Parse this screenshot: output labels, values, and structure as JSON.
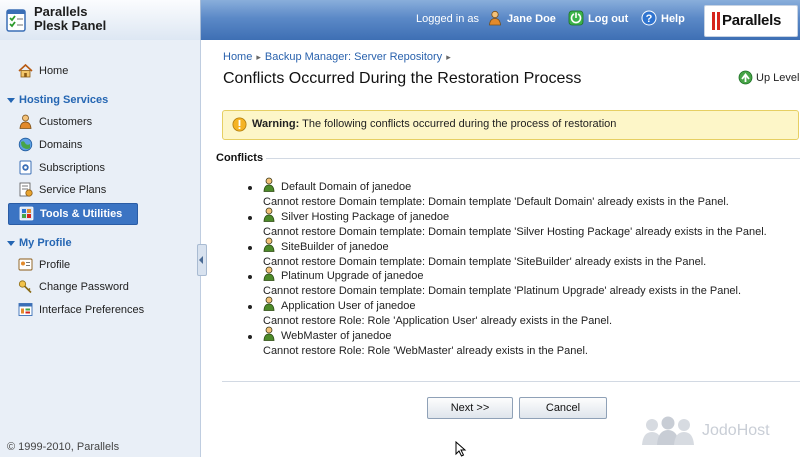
{
  "header": {
    "brand_line1": "Parallels",
    "brand_line2": "Plesk Panel",
    "logged_in_as": "Logged in as",
    "user_name": "Jane Doe",
    "logout_label": "Log out",
    "help_label": "Help",
    "logo_text": "Parallels"
  },
  "sidebar": {
    "home": "Home",
    "hosting_services_title": "Hosting Services",
    "hosting_items": [
      "Customers",
      "Domains",
      "Subscriptions",
      "Service Plans",
      "Tools & Utilities"
    ],
    "my_profile_title": "My Profile",
    "profile_items": [
      "Profile",
      "Change Password",
      "Interface Preferences"
    ],
    "copyright": "© 1999-2010, Parallels"
  },
  "main": {
    "breadcrumb": [
      "Home",
      "Backup Manager: Server Repository"
    ],
    "title": "Conflicts Occurred During the Restoration Process",
    "up_level": "Up Level",
    "warning_label": "Warning:",
    "warning_text": "The following conflicts occurred during the process of restoration",
    "conflicts_title": "Conflicts",
    "conflicts": [
      {
        "name": "Default Domain of janedoe",
        "message": "Cannot restore Domain template: Domain template 'Default Domain' already exists in the Panel."
      },
      {
        "name": "Silver Hosting Package of janedoe",
        "message": "Cannot restore Domain template: Domain template 'Silver Hosting Package' already exists in the Panel."
      },
      {
        "name": "SiteBuilder of janedoe",
        "message": "Cannot restore Domain template: Domain template 'SiteBuilder' already exists in the Panel."
      },
      {
        "name": "Platinum Upgrade of janedoe",
        "message": "Cannot restore Domain template: Domain template 'Platinum Upgrade' already exists in the Panel."
      },
      {
        "name": "Application User of janedoe",
        "message": "Cannot restore Role: Role 'Application User' already exists in the Panel."
      },
      {
        "name": "WebMaster of janedoe",
        "message": "Cannot restore Role: Role 'WebMaster' already exists in the Panel."
      }
    ],
    "next_button": "Next >>",
    "cancel_button": "Cancel"
  },
  "watermark": "JodoHost",
  "colors": {
    "header_blue": "#3e6fb4",
    "sidebar_bg": "#e9eff7",
    "active_item": "#3b74c3",
    "section_blue": "#2566b3",
    "warning_bg": "#fdf6c8"
  }
}
